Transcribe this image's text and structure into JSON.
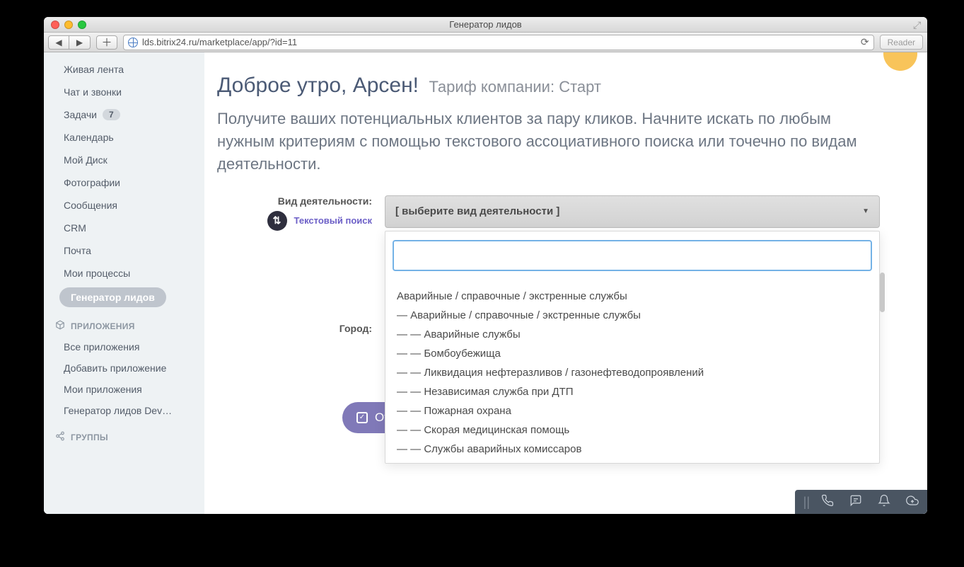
{
  "window_title": "Генератор лидов",
  "address_bar": "lds.bitrix24.ru/marketplace/app/?id=11",
  "reader_btn": "Reader",
  "sidebar": {
    "items": [
      {
        "label": "Живая лента",
        "name": "feed"
      },
      {
        "label": "Чат и звонки",
        "name": "chat"
      },
      {
        "label": "Задачи",
        "name": "tasks",
        "badge": "7"
      },
      {
        "label": "Календарь",
        "name": "calendar"
      },
      {
        "label": "Мой Диск",
        "name": "disk"
      },
      {
        "label": "Фотографии",
        "name": "photos"
      },
      {
        "label": "Сообщения",
        "name": "messages"
      },
      {
        "label": "CRM",
        "name": "crm"
      },
      {
        "label": "Почта",
        "name": "mail"
      },
      {
        "label": "Мои процессы",
        "name": "processes"
      },
      {
        "label": "Генератор лидов",
        "name": "lead-generator",
        "active": true
      }
    ],
    "apps_header": "ПРИЛОЖЕНИЯ",
    "apps": [
      "Все приложения",
      "Добавить приложение",
      "Мои приложения",
      "Генератор лидов Dev…"
    ],
    "groups_header": "ГРУППЫ"
  },
  "main": {
    "greeting": "Доброе утро, Арсен!",
    "tariff": "Тариф компании: Старт",
    "subtitle": "Получите ваших потенциальных клиентов за пару кликов. Начните искать по любым нужным критериям с помощью текстового ассоциативного поиска или точечно по видам деятельности.",
    "field_activity_label": "Вид деятельности:",
    "text_search_label": "Текстовый поиск",
    "select_placeholder": "[ выберите вид деятельности ]",
    "city_label": "Город:",
    "submit_label": "Отк"
  },
  "dropdown": {
    "items": [
      {
        "indent": 0,
        "label": "Аварийные / справочные / экстренные службы"
      },
      {
        "indent": 1,
        "label": "Аварийные / справочные / экстренные службы"
      },
      {
        "indent": 2,
        "label": "Аварийные службы"
      },
      {
        "indent": 2,
        "label": "Бомбоубежища"
      },
      {
        "indent": 2,
        "label": "Ликвидация нефтеразливов / газонефтеводопроявлений"
      },
      {
        "indent": 2,
        "label": "Независимая служба при ДТП"
      },
      {
        "indent": 2,
        "label": "Пожарная охрана"
      },
      {
        "indent": 2,
        "label": "Скорая медицинская помощь"
      },
      {
        "indent": 2,
        "label": "Службы аварийных комиссаров"
      }
    ]
  }
}
